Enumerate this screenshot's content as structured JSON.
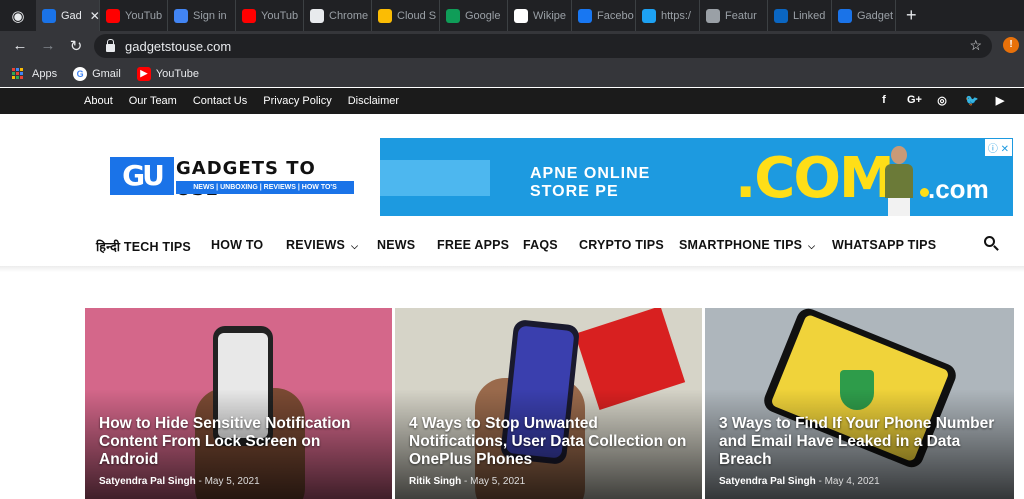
{
  "browser": {
    "tabs": [
      {
        "label": "Gad",
        "active": true,
        "icon": "gtu-icon",
        "color": "#1a73e8"
      },
      {
        "label": "YouTub",
        "icon": "youtube-icon",
        "color": "#ff0000"
      },
      {
        "label": "Sign in",
        "icon": "google-icon",
        "color": "#4285f4"
      },
      {
        "label": "YouTub",
        "icon": "youtube-icon",
        "color": "#ff0000"
      },
      {
        "label": "Chrome",
        "icon": "chrome-store-icon",
        "color": "#e8eaed"
      },
      {
        "label": "Cloud S",
        "icon": "drive-icon",
        "color": "#fbbc04"
      },
      {
        "label": "Google",
        "icon": "sheets-icon",
        "color": "#0f9d58"
      },
      {
        "label": "Wikipe",
        "icon": "wikipedia-icon",
        "color": "#ffffff"
      },
      {
        "label": "Facebo",
        "icon": "facebook-icon",
        "color": "#1877f2"
      },
      {
        "label": "https:/",
        "icon": "twitter-icon",
        "color": "#1da1f2"
      },
      {
        "label": "Featur",
        "icon": "featured-icon",
        "color": "#9aa0a6"
      },
      {
        "label": "Linked",
        "icon": "linkedin-icon",
        "color": "#0a66c2"
      },
      {
        "label": "Gadget",
        "icon": "gtu-icon",
        "color": "#1a73e8"
      }
    ],
    "url": "gadgetstouse.com",
    "bookmarks": {
      "apps": "Apps",
      "gmail": "Gmail",
      "youtube": "YouTube"
    }
  },
  "topbar": {
    "links": [
      "About",
      "Our Team",
      "Contact Us",
      "Privacy Policy",
      "Disclaimer"
    ],
    "social": [
      "f",
      "G+",
      "◎",
      "🐦",
      "▶"
    ]
  },
  "logo": {
    "mark": "GU",
    "title": "GADGETS TO USE",
    "tagline": "NEWS | UNBOXING | REVIEWS | HOW TO'S"
  },
  "ad": {
    "line1": "APNE ONLINE",
    "line2": "STORE PE",
    "big": ".COM",
    "small": ".com",
    "badge": "ⓘ ✕"
  },
  "nav": {
    "items": [
      {
        "label": "हिन्दी TECH TIPS",
        "dropdown": false
      },
      {
        "label": "HOW TO",
        "dropdown": false
      },
      {
        "label": "REVIEWS",
        "dropdown": true
      },
      {
        "label": "NEWS",
        "dropdown": false
      },
      {
        "label": "FREE APPS",
        "dropdown": false
      },
      {
        "label": "FAQS",
        "dropdown": false
      },
      {
        "label": "CRYPTO TIPS",
        "dropdown": false
      },
      {
        "label": "SMARTPHONE TIPS",
        "dropdown": true
      },
      {
        "label": "WHATSAPP TIPS",
        "dropdown": false
      }
    ]
  },
  "articles": [
    {
      "title": "How to Hide Sensitive Notification Content From Lock Screen on Android",
      "author": "Satyendra Pal Singh",
      "date": "May 5, 2021"
    },
    {
      "title": "4 Ways to Stop Unwanted Notifications, User Data Collection on OnePlus Phones",
      "author": "Ritik Singh",
      "date": "May 5, 2021"
    },
    {
      "title": "3 Ways to Find If Your Phone Number and Email Have Leaked in a Data Breach",
      "author": "Satyendra Pal Singh",
      "date": "May 4, 2021"
    }
  ]
}
